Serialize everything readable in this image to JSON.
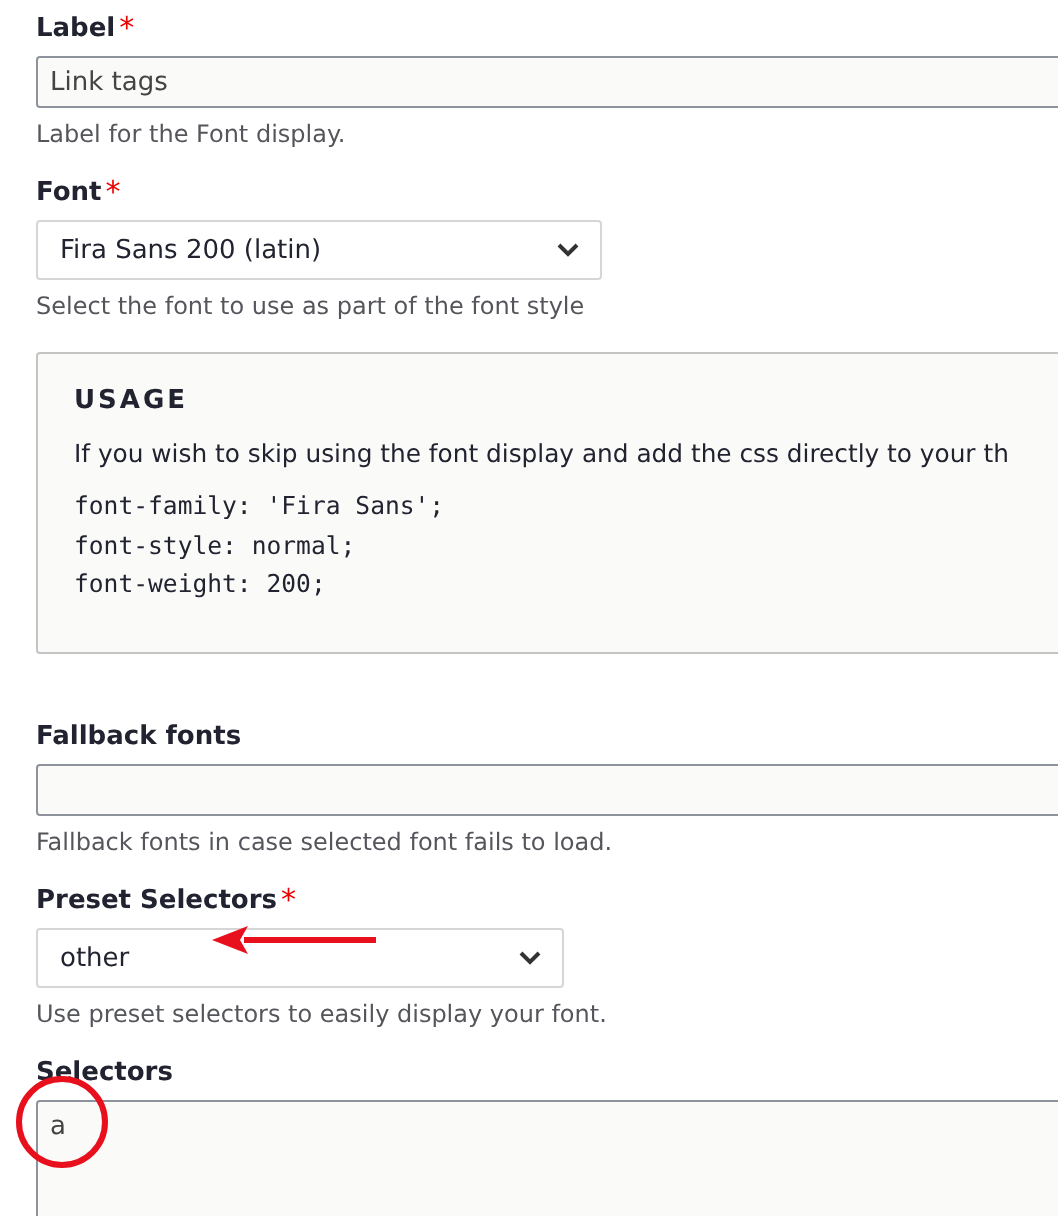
{
  "fields": [
    {
      "kind": "text",
      "label": "Label",
      "required_marker": "*",
      "value": "Link tags",
      "description": "Label for the Font display."
    },
    {
      "kind": "select",
      "label": "Font",
      "required_marker": "*",
      "value": "Fira Sans 200 (latin)",
      "description": "Select the font to use as part of the font style"
    },
    {
      "kind": "usage",
      "title": "USAGE",
      "text": "If you wish to skip using the font display and add the css directly to your th",
      "code": [
        "font-family: 'Fira Sans';",
        "font-style: normal;",
        "font-weight: 200;"
      ]
    },
    {
      "kind": "text",
      "label": "Fallback fonts",
      "description": "Fallback fonts in case selected font fails to load."
    },
    {
      "kind": "select",
      "label": "Preset Selectors",
      "required_marker": "*",
      "value": "other",
      "description": "Use preset selectors to easily display your font."
    },
    {
      "kind": "textarea",
      "label": "Selectors",
      "value": "a"
    }
  ]
}
